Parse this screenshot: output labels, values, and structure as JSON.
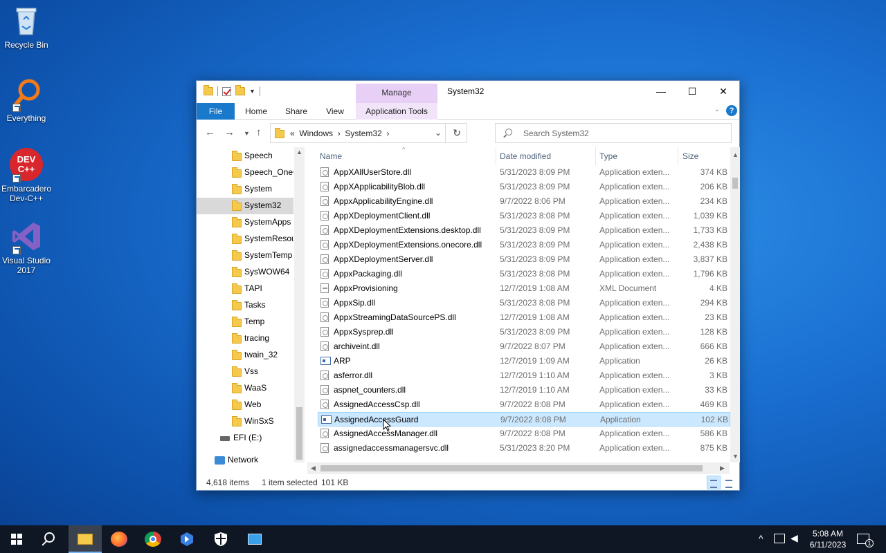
{
  "desktop": {
    "icons": [
      {
        "label": "Recycle Bin"
      },
      {
        "label": "Everything"
      },
      {
        "label": "Embarcadero\nDev-C++",
        "logo_text": "DEV\nC++"
      },
      {
        "label": "Visual Studio\n2017"
      }
    ]
  },
  "window": {
    "title": "System32",
    "contextual_tab": "Manage",
    "ribbon_tabs": [
      "File",
      "Home",
      "Share",
      "View",
      "Application Tools"
    ],
    "controls": {
      "minimize": "—",
      "maximize": "☐",
      "close": "✕"
    },
    "help": "?"
  },
  "address": {
    "prefix": "«",
    "crumbs": [
      "Windows",
      "System32"
    ],
    "separator": "›"
  },
  "search": {
    "placeholder": "Search System32"
  },
  "nav_pane": {
    "folders": [
      "Speech",
      "Speech_OneCore",
      "System",
      "System32",
      "SystemApps",
      "SystemResources",
      "SystemTemp",
      "SysWOW64",
      "TAPI",
      "Tasks",
      "Temp",
      "tracing",
      "twain_32",
      "Vss",
      "WaaS",
      "Web",
      "WinSxS"
    ],
    "selected": "System32",
    "drive": "EFI (E:)",
    "network": "Network"
  },
  "list": {
    "columns": [
      "Name",
      "Date modified",
      "Type",
      "Size"
    ],
    "rows": [
      {
        "name": "AppXAllUserStore.dll",
        "date": "5/31/2023 8:09 PM",
        "type": "Application exten...",
        "size": "374 KB",
        "icon": "dll"
      },
      {
        "name": "AppXApplicabilityBlob.dll",
        "date": "5/31/2023 8:09 PM",
        "type": "Application exten...",
        "size": "206 KB",
        "icon": "dll"
      },
      {
        "name": "AppxApplicabilityEngine.dll",
        "date": "9/7/2022 8:06 PM",
        "type": "Application exten...",
        "size": "234 KB",
        "icon": "dll"
      },
      {
        "name": "AppXDeploymentClient.dll",
        "date": "5/31/2023 8:08 PM",
        "type": "Application exten...",
        "size": "1,039 KB",
        "icon": "dll"
      },
      {
        "name": "AppXDeploymentExtensions.desktop.dll",
        "date": "5/31/2023 8:09 PM",
        "type": "Application exten...",
        "size": "1,733 KB",
        "icon": "dll"
      },
      {
        "name": "AppXDeploymentExtensions.onecore.dll",
        "date": "5/31/2023 8:09 PM",
        "type": "Application exten...",
        "size": "2,438 KB",
        "icon": "dll"
      },
      {
        "name": "AppXDeploymentServer.dll",
        "date": "5/31/2023 8:09 PM",
        "type": "Application exten...",
        "size": "3,837 KB",
        "icon": "dll"
      },
      {
        "name": "AppxPackaging.dll",
        "date": "5/31/2023 8:08 PM",
        "type": "Application exten...",
        "size": "1,796 KB",
        "icon": "dll"
      },
      {
        "name": "AppxProvisioning",
        "date": "12/7/2019 1:08 AM",
        "type": "XML Document",
        "size": "4 KB",
        "icon": "xml"
      },
      {
        "name": "AppxSip.dll",
        "date": "5/31/2023 8:08 PM",
        "type": "Application exten...",
        "size": "294 KB",
        "icon": "dll"
      },
      {
        "name": "AppxStreamingDataSourcePS.dll",
        "date": "12/7/2019 1:08 AM",
        "type": "Application exten...",
        "size": "23 KB",
        "icon": "dll"
      },
      {
        "name": "AppxSysprep.dll",
        "date": "5/31/2023 8:09 PM",
        "type": "Application exten...",
        "size": "128 KB",
        "icon": "dll"
      },
      {
        "name": "archiveint.dll",
        "date": "9/7/2022 8:07 PM",
        "type": "Application exten...",
        "size": "666 KB",
        "icon": "dll"
      },
      {
        "name": "ARP",
        "date": "12/7/2019 1:09 AM",
        "type": "Application",
        "size": "26 KB",
        "icon": "app"
      },
      {
        "name": "asferror.dll",
        "date": "12/7/2019 1:10 AM",
        "type": "Application exten...",
        "size": "3 KB",
        "icon": "dll"
      },
      {
        "name": "aspnet_counters.dll",
        "date": "12/7/2019 1:10 AM",
        "type": "Application exten...",
        "size": "33 KB",
        "icon": "dll"
      },
      {
        "name": "AssignedAccessCsp.dll",
        "date": "9/7/2022 8:08 PM",
        "type": "Application exten...",
        "size": "469 KB",
        "icon": "dll"
      },
      {
        "name": "AssignedAccessGuard",
        "date": "9/7/2022 8:08 PM",
        "type": "Application",
        "size": "102 KB",
        "icon": "app",
        "selected": true
      },
      {
        "name": "AssignedAccessManager.dll",
        "date": "9/7/2022 8:08 PM",
        "type": "Application exten...",
        "size": "586 KB",
        "icon": "dll"
      },
      {
        "name": "assignedaccessmanagersvc.dll",
        "date": "5/31/2023 8:20 PM",
        "type": "Application exten...",
        "size": "875 KB",
        "icon": "dll"
      }
    ]
  },
  "status": {
    "items": "4,618 items",
    "selected": "1 item selected",
    "size": "101 KB"
  },
  "taskbar": {
    "clock_time": "5:08 AM",
    "clock_date": "6/11/2023",
    "notification_count": "1"
  },
  "colors": {
    "accent": "#1979ca",
    "selection": "#cce8ff",
    "taskbar": "#101724"
  }
}
